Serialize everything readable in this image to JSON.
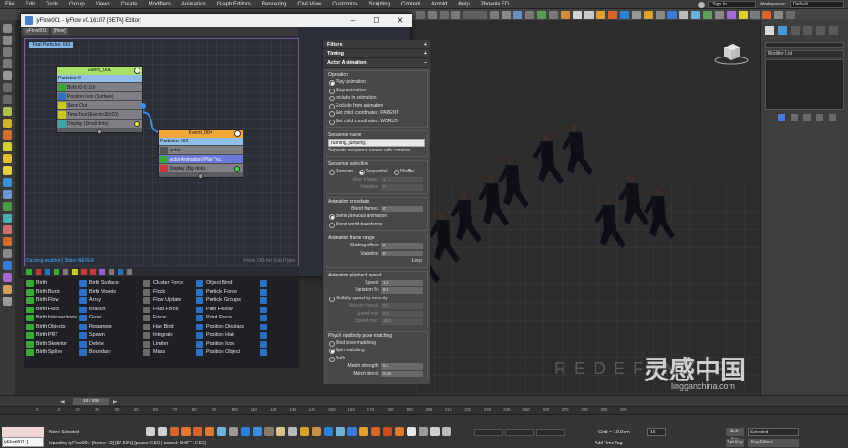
{
  "menu": {
    "items": [
      "File",
      "Edit",
      "Tools",
      "Group",
      "Views",
      "Create",
      "Modifiers",
      "Animation",
      "Graph Editors",
      "Rendering",
      "Civil View",
      "Customize",
      "Scripting",
      "Content",
      "Arnold",
      "Help",
      "Phoenix FD"
    ],
    "sign_in": "Sign In",
    "workspaces_label": "Workspaces:",
    "workspace_value": "Default"
  },
  "editor": {
    "title": "tyFlow001 - tyFlow v0.16107 [BETA] Editor]",
    "flow_tab": "tyFlow001",
    "new_tab": "[New]",
    "total_particles": "Total Particles: 660",
    "caching_status": "Caching enabled | Static: NEVER",
    "tab_tip": "Press TAB for QuickType",
    "event1": {
      "title": "Event_001",
      "count": "Particles: 0",
      "operators": [
        "Birth (0-0: 10)",
        "Position Icon (Surface)",
        "Send Out",
        "Time Test (Event>30±20)",
        "Display (Small dots)"
      ]
    },
    "event4": {
      "title": "Event_004",
      "count": "Particles: 660",
      "operators": [
        "Actor",
        "Actor Animation (Play \"ru...",
        "Display (Big dots)"
      ]
    }
  },
  "palette": {
    "items": [
      "Birth",
      "Birth Surface",
      "Cluster Force",
      "Object Bind",
      "",
      "Birth Burst",
      "Birth Voxels",
      "Flock",
      "Particle Force",
      "",
      "Birth Flow",
      "Array",
      "Flow Update",
      "Particle Groups",
      "",
      "Birth Fluid",
      "Branch",
      "Fluid Force",
      "Path Follow",
      "",
      "Birth Intersections",
      "Grow",
      "Force",
      "Point Force",
      "",
      "Birth Objects",
      "Resample",
      "Hair Bind",
      "Position Displace",
      "",
      "Birth PRT",
      "Spawn",
      "Integrate",
      "Position Hair",
      "",
      "Birth Skeleton",
      "Delete",
      "Limiter",
      "Position Icon",
      "",
      "Birth Spline",
      "Boundary",
      "Mass",
      "Position Object",
      ""
    ]
  },
  "params": {
    "rollouts": {
      "filters": "Filters",
      "timing": "Timing",
      "actor_animation": "Actor Animation"
    },
    "operation_title": "Operation",
    "operations": [
      "Play animation",
      "Stop animation",
      "Include in animation",
      "Exclude from animation",
      "Set child coordinates: PARENT",
      "Set child coordinates: WORLD"
    ],
    "sequence_name_title": "Sequence name",
    "sequence_name_value": "running, jumping,",
    "sequence_hint": "Separate sequence names with commas.",
    "sequence_selection_title": "Sequence selection",
    "sequence_modes": [
      "Random",
      "Sequential",
      "Shuffle"
    ],
    "after_n_loops": "After # loops:",
    "after_n_loops_value": "1",
    "variation_label": "Variation:",
    "variation_value": "0",
    "crossfade_title": "Animation crossfade",
    "blend_frames_label": "Blend frames:",
    "blend_frames_value": "0",
    "blend_previous": "Blend previous animation",
    "blend_world": "Blend world transforms",
    "frame_range_title": "Animation frame range",
    "starting_offset_label": "Starting offset:",
    "starting_offset_value": "0",
    "range_variation_label": "Variation:",
    "range_variation_value": "0",
    "loop_label": "Loop",
    "playback_title": "Animation playback speed",
    "speed_label": "Speed:",
    "speed_value": "1.0",
    "variation_pct_label": "Variation %:",
    "variation_pct_value": "0.0",
    "multiply_velocity": "Multiply speed by velocity",
    "velocity_thresh_label": "Velocity thresh:",
    "velocity_thresh_value": "0.0",
    "speed_min_label": "Speed min:",
    "speed_min_value": "0.0",
    "speed_max_label": "Speed max:",
    "speed_max_value": "10.0",
    "physx_title": "PhysX rigidbody pose matching",
    "physx_modes": [
      "Bind pose matching",
      "Spin matching",
      "Both"
    ],
    "match_strength_label": "Match strength:",
    "match_strength_value": "0.4",
    "match_blend_label": "Match blend:",
    "match_blend_value": "0.75"
  },
  "cmdpanel": {
    "modifier_list": "Modifier List"
  },
  "viewport": {
    "watermark": "REDEFINE FX",
    "cn_watermark": "灵感中国",
    "cn_url": "lingganchina.com"
  },
  "timeline": {
    "slider": "16 / 300",
    "ticks": [
      "0",
      "10",
      "20",
      "30",
      "40",
      "50",
      "60",
      "70",
      "80",
      "90",
      "100",
      "110",
      "120",
      "130",
      "140",
      "150",
      "160",
      "170",
      "180",
      "190",
      "200",
      "210",
      "220",
      "230",
      "240",
      "250",
      "260",
      "270",
      "280",
      "290",
      "300"
    ]
  },
  "status": {
    "maxscript": "tyFlow001: [",
    "selection": "None Selected",
    "prompt": "Updating tyFlow001: [frame: 10] [57.53%] [pause: ESC | cancel: SHIFT+ESC]",
    "grid": "Grid = 10.0cm",
    "add_time_tag": "Add Time Tag",
    "frame": "16",
    "auto_key": "Auto Key",
    "set_key": "Set Key",
    "key_select": "Selected",
    "key_filters": "Key Filters..."
  },
  "colors": {
    "event1_head": "#a8e06a",
    "event4_head": "#f3a93a",
    "actor_animation_row": "#6b7ad8",
    "display_row": "#d49a9a",
    "total_particles_bg": "#7fb4e6"
  }
}
